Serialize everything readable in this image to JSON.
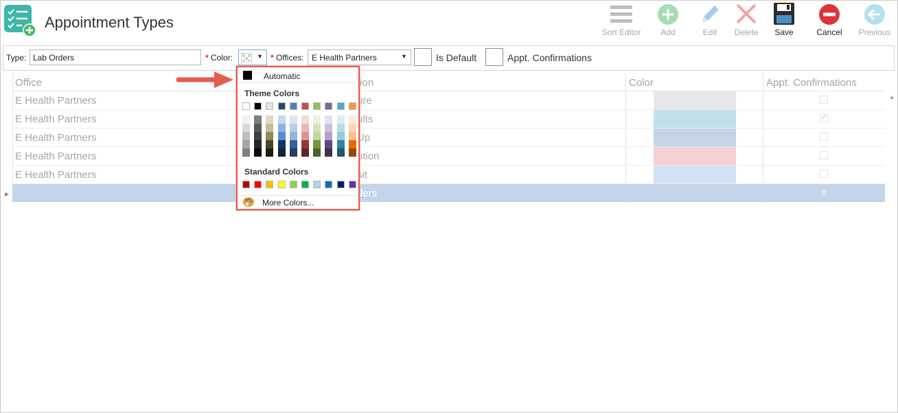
{
  "header": {
    "title": "Appointment Types"
  },
  "toolbar": {
    "sort_editor": "Sort Editor",
    "add": "Add",
    "edit": "Edit",
    "delete": "Delete",
    "save": "Save",
    "cancel": "Cancel",
    "previous": "Previous"
  },
  "filters": {
    "type_label": "Type:",
    "type_value": "Lab Orders",
    "required_mark": "*",
    "color_label": "Color:",
    "offices_label": "Offices:",
    "offices_value": "E Health Partners",
    "is_default_label": "Is Default",
    "appt_confirmations_label": "Appt. Confirmations"
  },
  "grid": {
    "columns": [
      "Office",
      "tion",
      "Color",
      "Appt. Confirmations"
    ],
    "rows": [
      {
        "office": "E Health Partners",
        "desc": "ure",
        "color": "#e8e8e8",
        "checked": false
      },
      {
        "office": "E Health Partners",
        "desc": "ults",
        "color": "#bfe2e8",
        "checked": true
      },
      {
        "office": "E Health Partners",
        "desc": "Up",
        "color": "#c5d3e8",
        "checked": false
      },
      {
        "office": "E Health Partners",
        "desc": "ption",
        "color": "#f5d0d2",
        "checked": false
      },
      {
        "office": "E Health Partners",
        "desc": "sit",
        "color": "#d3e1f5",
        "checked": false
      },
      {
        "office": "",
        "desc": "ders",
        "color": "#c3d5ea",
        "checked": false
      }
    ]
  },
  "color_picker": {
    "automatic": "Automatic",
    "theme_colors_title": "Theme Colors",
    "standard_colors_title": "Standard Colors",
    "more_colors": "More Colors...",
    "theme_top": [
      "#ffffff",
      "#000000",
      "#e7e6de",
      "#1f497d",
      "#4f81bd",
      "#c0504d",
      "#9bbb59",
      "#8064a2",
      "#4bacc6",
      "#f79646"
    ],
    "theme_shades": [
      [
        "#f2f2f2",
        "#d9d9d9",
        "#bfbfbf",
        "#a6a6a6",
        "#808080"
      ],
      [
        "#7f7f7f",
        "#595959",
        "#404040",
        "#262626",
        "#0d0d0d"
      ],
      [
        "#ddd9c3",
        "#c4bd97",
        "#938953",
        "#4a452a",
        "#1e1c11"
      ],
      [
        "#c6d9f0",
        "#8db3e2",
        "#548dd4",
        "#17365d",
        "#0f243e"
      ],
      [
        "#dbe5f1",
        "#b8cce4",
        "#95b3d7",
        "#366092",
        "#244061"
      ],
      [
        "#f2dcdb",
        "#e5b9b7",
        "#d99694",
        "#953734",
        "#632423"
      ],
      [
        "#ebf1dd",
        "#d7e3bc",
        "#c3d69b",
        "#76923c",
        "#4f6128"
      ],
      [
        "#e5e0ec",
        "#ccc1d9",
        "#b2a2c7",
        "#5f497a",
        "#3f3151"
      ],
      [
        "#dbeef3",
        "#b7dde8",
        "#92cddc",
        "#31859b",
        "#205867"
      ],
      [
        "#fdeada",
        "#fbd5b5",
        "#fac08f",
        "#e36c09",
        "#974806"
      ]
    ],
    "standard": [
      "#c00000",
      "#ff0000",
      "#ffc000",
      "#ffff00",
      "#92d050",
      "#00b050",
      "#add8e6",
      "#0070c0",
      "#002060",
      "#7030a0"
    ]
  },
  "accent_colors": {
    "callout_red": "#e35d4f",
    "selection_blue": "#c3d5ea"
  }
}
